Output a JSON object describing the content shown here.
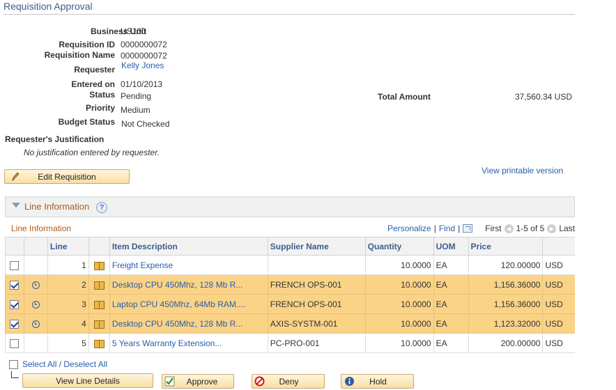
{
  "page": {
    "title": "Requisition Approval"
  },
  "header": {
    "business_unit_label": "Business Unit",
    "business_unit": "US100",
    "req_id_label": "Requisition ID",
    "req_id": "0000000072",
    "req_name_label": "Requisition Name",
    "req_name": "0000000072",
    "requester_label": "Requester",
    "requester": "Kelly Jones",
    "entered_label": "Entered on",
    "entered": "01/10/2013",
    "status_label": "Status",
    "status": "Pending",
    "priority_label": "Priority",
    "priority": "Medium",
    "budget_label": "Budget Status",
    "budget": "Not Checked",
    "total_label": "Total Amount",
    "total": "37,560.34 USD"
  },
  "justification": {
    "label": "Requester's Justification",
    "text": "No justification entered by requester."
  },
  "actions": {
    "edit": "Edit Requisition",
    "printable": "View printable version"
  },
  "section": {
    "title": "Line Information",
    "help": "?"
  },
  "grid": {
    "title": "Line Information",
    "personalize": "Personalize",
    "find": "Find",
    "sep": "|",
    "first": "First",
    "range": "1-5 of 5",
    "last": "Last",
    "columns": [
      "Line",
      "Item Description",
      "Supplier Name",
      "Quantity",
      "UOM",
      "Price"
    ],
    "rows": [
      {
        "checked": false,
        "clock": false,
        "line": "1",
        "item": "Freight Expense",
        "supplier": "",
        "qty": "10.0000",
        "uom": "EA",
        "price": "120.00000",
        "cur": "USD"
      },
      {
        "checked": true,
        "clock": true,
        "line": "2",
        "item": "Desktop CPU 450Mhz, 128 Mb R...",
        "supplier": "FRENCH OPS-001",
        "qty": "10.0000",
        "uom": "EA",
        "price": "1,156.36000",
        "cur": "USD"
      },
      {
        "checked": true,
        "clock": true,
        "line": "3",
        "item": "Laptop CPU 450Mhz, 64Mb RAM....",
        "supplier": "FRENCH OPS-001",
        "qty": "10.0000",
        "uom": "EA",
        "price": "1,156.36000",
        "cur": "USD"
      },
      {
        "checked": true,
        "clock": true,
        "line": "4",
        "item": "Desktop CPU 450Mhz, 128 Mb R...",
        "supplier": "AXIS-SYSTM-001",
        "qty": "10.0000",
        "uom": "EA",
        "price": "1,123.32000",
        "cur": "USD"
      },
      {
        "checked": false,
        "clock": false,
        "line": "5",
        "item": "5 Years Warranty Extension...",
        "supplier": "PC-PRO-001",
        "qty": "10.0000",
        "uom": "EA",
        "price": "200.00000",
        "cur": "USD"
      }
    ]
  },
  "footer": {
    "select_all": "Select All / Deselect All",
    "view_details": "View Line Details",
    "approve": "Approve",
    "deny": "Deny",
    "hold": "Hold"
  }
}
